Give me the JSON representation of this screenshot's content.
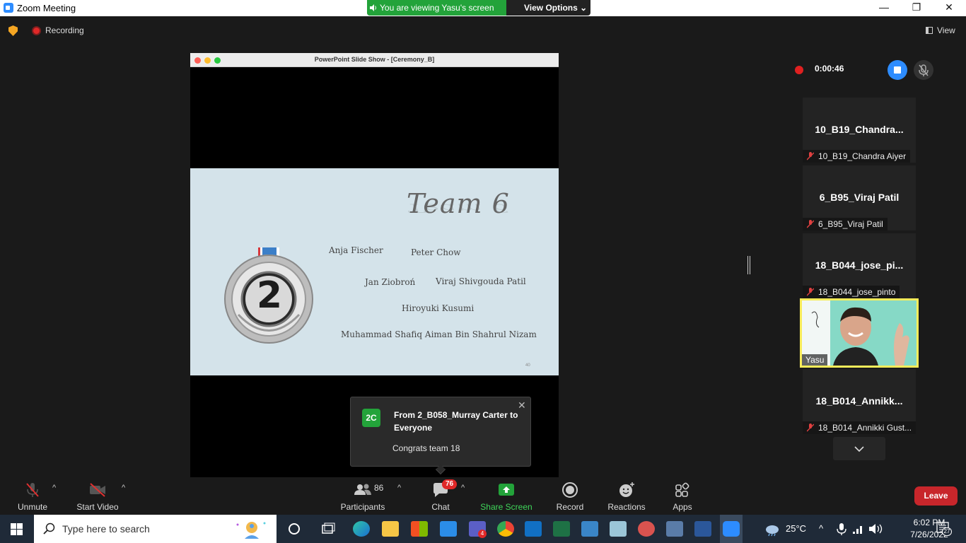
{
  "window": {
    "title": "Zoom Meeting",
    "viewing_banner": "You are viewing Yasu's screen",
    "view_options": "View Options",
    "minimize": "—",
    "maximize": "❐",
    "close": "✕"
  },
  "top_bar": {
    "recording_label": "Recording",
    "view_label": "View"
  },
  "shared_window": {
    "title": "PowerPoint Slide Show - [Ceremony_B]"
  },
  "slide": {
    "title": "Team 6",
    "medal_number": "2",
    "names": [
      "Anja Fischer",
      "Peter Chow",
      "Jan Ziobroń",
      "Viraj Shivgouda Patil",
      "Hiroyuki Kusumi",
      "Muhammad Shafiq Aiman Bin Shahrul Nizam"
    ],
    "page_number": "40"
  },
  "chat_toast": {
    "avatar_initials": "2C",
    "from_line": "From 2_B058_Murray Carter to Everyone",
    "message": "Congrats team 18",
    "close": "✕"
  },
  "recording_panel": {
    "elapsed": "0:00:46"
  },
  "participants_panel": {
    "tiles": [
      {
        "name": "10_B19_Chandra...",
        "label": "10_B19_Chandra Aiyer"
      },
      {
        "name": "6_B95_Viraj Patil",
        "label": "6_B95_Viraj Patil"
      },
      {
        "name": "18_B044_jose_pi...",
        "label": "18_B044_jose_pinto"
      },
      {
        "name": "18_B014_Annikk...",
        "label": "18_B014_Annikki Gust..."
      }
    ],
    "video_tile": {
      "label": "Yasu"
    }
  },
  "toolbar": {
    "unmute": "Unmute",
    "start_video": "Start Video",
    "participants": "Participants",
    "participants_count": "86",
    "chat": "Chat",
    "chat_badge": "76",
    "share_screen": "Share Screen",
    "record": "Record",
    "reactions": "Reactions",
    "apps": "Apps",
    "leave": "Leave"
  },
  "taskbar": {
    "search_placeholder": "Type here to search",
    "temperature": "25°C",
    "time": "6:02 PM",
    "date": "7/26/2022",
    "notifications": "27",
    "teams_badge": "4"
  },
  "colors": {
    "accent_blue": "#2d8cff",
    "green": "#23a33a",
    "leave_red": "#c8262b",
    "active_speaker_border": "#f7ec5a"
  }
}
